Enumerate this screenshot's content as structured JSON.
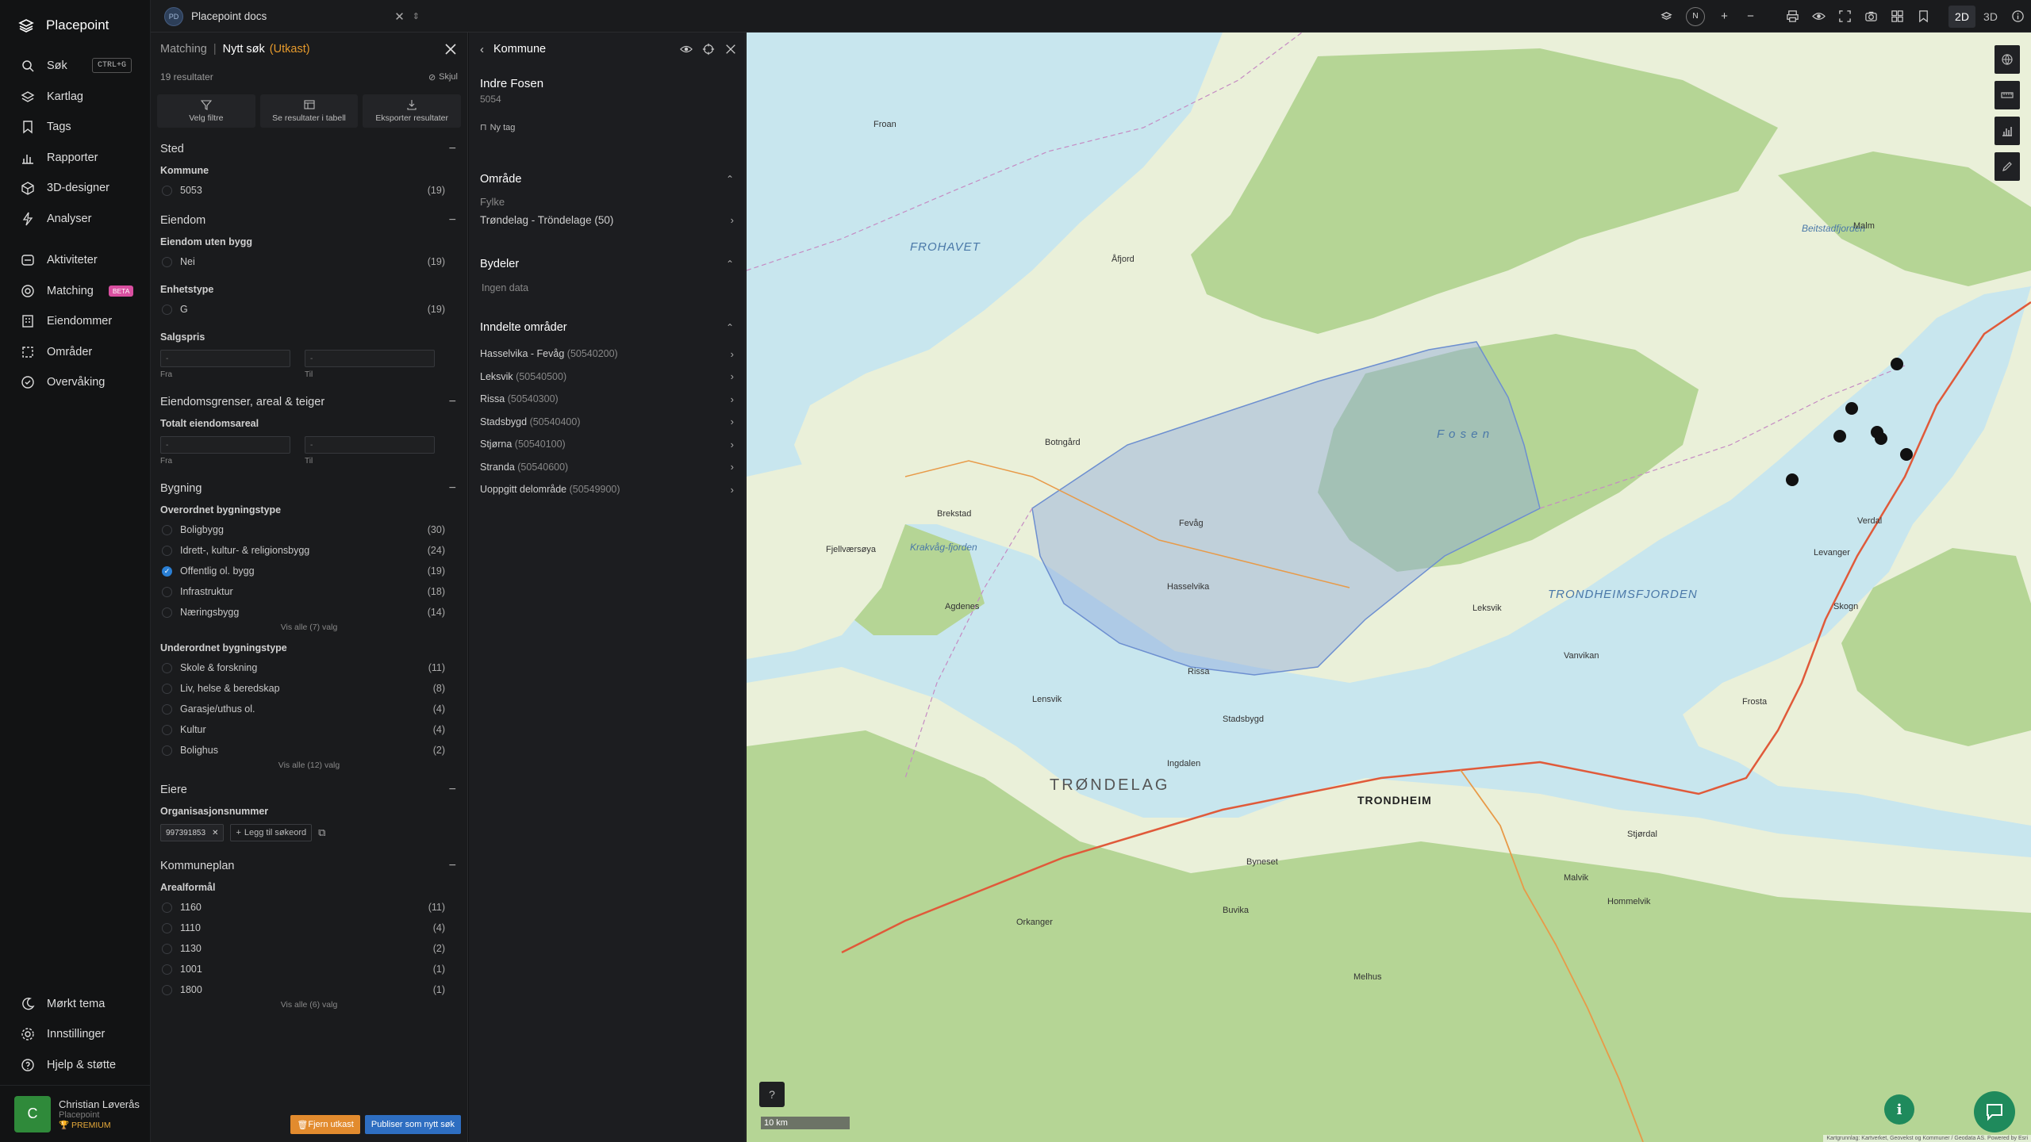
{
  "app": {
    "name": "Placepoint"
  },
  "nav": {
    "items": [
      {
        "label": "Søk",
        "icon": "search-icon",
        "shortcut": "CTRL+G"
      },
      {
        "label": "Kartlag",
        "icon": "layers-icon"
      },
      {
        "label": "Tags",
        "icon": "bookmark-icon"
      },
      {
        "label": "Rapporter",
        "icon": "chart-icon"
      },
      {
        "label": "3D-designer",
        "icon": "cube-icon"
      },
      {
        "label": "Analyser",
        "icon": "bolt-icon"
      }
    ],
    "items2": [
      {
        "label": "Aktiviteter",
        "icon": "activity-icon"
      },
      {
        "label": "Matching",
        "icon": "target-icon",
        "badge": "BETA"
      },
      {
        "label": "Eiendommer",
        "icon": "building-icon"
      },
      {
        "label": "Områder",
        "icon": "area-icon"
      },
      {
        "label": "Overvåking",
        "icon": "monitor-icon"
      }
    ],
    "bottom": [
      {
        "label": "Mørkt tema",
        "icon": "moon-icon"
      },
      {
        "label": "Innstillinger",
        "icon": "gear-icon"
      },
      {
        "label": "Hjelp & støtte",
        "icon": "help-icon"
      }
    ],
    "user": {
      "initial": "C",
      "name": "Christian Løverås",
      "org": "Placepoint",
      "plan": "PREMIUM"
    }
  },
  "topbar": {
    "docs_badge": "PD",
    "docs_title": "Placepoint docs",
    "view_2d": "2D",
    "view_3d": "3D",
    "north": "N"
  },
  "matching": {
    "crumb": "Matching",
    "title": "Nytt søk",
    "status": "(Utkast)",
    "results": "19 resultater",
    "hide": "Skjul",
    "actions": [
      "Velg filtre",
      "Se resultater i tabell",
      "Eksporter resultater"
    ],
    "sted": {
      "title": "Sted",
      "kommune_label": "Kommune",
      "options": [
        {
          "label": "5053",
          "count": "(19)"
        }
      ]
    },
    "eiendom": {
      "title": "Eiendom",
      "uten_bygg_label": "Eiendom uten bygg",
      "uten_bygg": [
        {
          "label": "Nei",
          "count": "(19)"
        }
      ],
      "enhetstype_label": "Enhetstype",
      "enhetstype": [
        {
          "label": "G",
          "count": "(19)"
        }
      ],
      "salgspris_label": "Salgspris",
      "from_label": "Fra",
      "to_label": "Til",
      "placeholder": "-"
    },
    "grenser": {
      "title": "Eiendomsgrenser, areal & teiger",
      "areal_label": "Totalt eiendomsareal",
      "from_label": "Fra",
      "to_label": "Til",
      "placeholder": "-"
    },
    "bygning": {
      "title": "Bygning",
      "overordnet_label": "Overordnet bygningstype",
      "overordnet": [
        {
          "label": "Boligbygg",
          "count": "(30)",
          "checked": false
        },
        {
          "label": "Idrett-, kultur- & religionsbygg",
          "count": "(24)",
          "checked": false
        },
        {
          "label": "Offentlig ol. bygg",
          "count": "(19)",
          "checked": true
        },
        {
          "label": "Infrastruktur",
          "count": "(18)",
          "checked": false
        },
        {
          "label": "Næringsbygg",
          "count": "(14)",
          "checked": false
        }
      ],
      "overordnet_more": "Vis alle (7) valg",
      "underordnet_label": "Underordnet bygningstype",
      "underordnet": [
        {
          "label": "Skole & forskning",
          "count": "(11)"
        },
        {
          "label": "Liv, helse & beredskap",
          "count": "(8)"
        },
        {
          "label": "Garasje/uthus ol.",
          "count": "(4)"
        },
        {
          "label": "Kultur",
          "count": "(4)"
        },
        {
          "label": "Bolighus",
          "count": "(2)"
        }
      ],
      "underordnet_more": "Vis alle (12) valg"
    },
    "eiere": {
      "title": "Eiere",
      "org_label": "Organisasjonsnummer",
      "org_value": "997391853",
      "add_keyword": "Legg til søkeord"
    },
    "kommuneplan": {
      "title": "Kommuneplan",
      "areal_label": "Arealformål",
      "options": [
        {
          "label": "1160",
          "count": "(11)"
        },
        {
          "label": "1110",
          "count": "(4)"
        },
        {
          "label": "1130",
          "count": "(2)"
        },
        {
          "label": "1001",
          "count": "(1)"
        },
        {
          "label": "1800",
          "count": "(1)"
        }
      ],
      "more": "Vis alle (6) valg"
    },
    "remove_draft": "Fjern utkast",
    "publish": "Publiser som nytt søk"
  },
  "kommune": {
    "header": "Kommune",
    "name": "Indre Fosen",
    "code": "5054",
    "new_tag": "Ny tag",
    "omrade_title": "Område",
    "fylke_label": "Fylke",
    "fylke_value": "Trøndelag - Tröndelage",
    "fylke_code": "(50)",
    "bydeler_title": "Bydeler",
    "bydeler_empty": "Ingen data",
    "inndelte_title": "Inndelte områder",
    "inndelte": [
      {
        "name": "Hasselvika - Fevåg",
        "code": "(50540200)"
      },
      {
        "name": "Leksvik",
        "code": "(50540500)"
      },
      {
        "name": "Rissa",
        "code": "(50540300)"
      },
      {
        "name": "Stadsbygd",
        "code": "(50540400)"
      },
      {
        "name": "Stjørna",
        "code": "(50540100)"
      },
      {
        "name": "Stranda",
        "code": "(50540600)"
      },
      {
        "name": "Uoppgitt delområde",
        "code": "(50549900)"
      }
    ]
  },
  "map": {
    "scale": "10 km",
    "attribution": "Kartgrunnlag: Kartverket, Geovekst og Kommuner / Geodata AS. Powered by Esri",
    "labels": {
      "frohavet": "FROHAVET",
      "trondelag": "TRØNDELAG",
      "trondheim": "TRONDHEIM",
      "fosen": "F o s e n",
      "trondheimsfjorden": "TRONDHEIMSFJORDEN",
      "trondheimsfjorden2": "TRONDHEIMSFJORDEN",
      "beitstadfjorden": "Beitstadfjorden",
      "kraakvagfjorden": "Krakvåg-fjorden",
      "leksvik": "Leksvik",
      "rissa": "Rissa",
      "stadsbygd": "Stadsbygd",
      "hasselvika": "Hasselvika",
      "fevag": "Fevåg",
      "botngard": "Botngård",
      "brekstad": "Brekstad",
      "orkanger": "Orkanger",
      "malvik": "Malvik",
      "stjordal": "Stjørdal",
      "levanger": "Levanger",
      "skogn": "Skogn",
      "verdal": "Verdal",
      "frosta": "Frosta",
      "agdenes": "Agdenes",
      "lensvik": "Lensvik",
      "vanvikan": "Vanvikan",
      "hitra": "Fjellværsøya",
      "afjord": "Åfjord",
      "froan": "Froan",
      "malm": "Malm",
      "ingdalen": "Ingdalen",
      "buvika": "Buvika",
      "byneset": "Byneset",
      "melhus": "Melhus",
      "hommelvik": "Hommelvik"
    },
    "colors": {
      "water": "#c8e6ee",
      "land": "#eaf0d9",
      "forest": "#b5d595",
      "selection": "#8fa9dc"
    }
  }
}
